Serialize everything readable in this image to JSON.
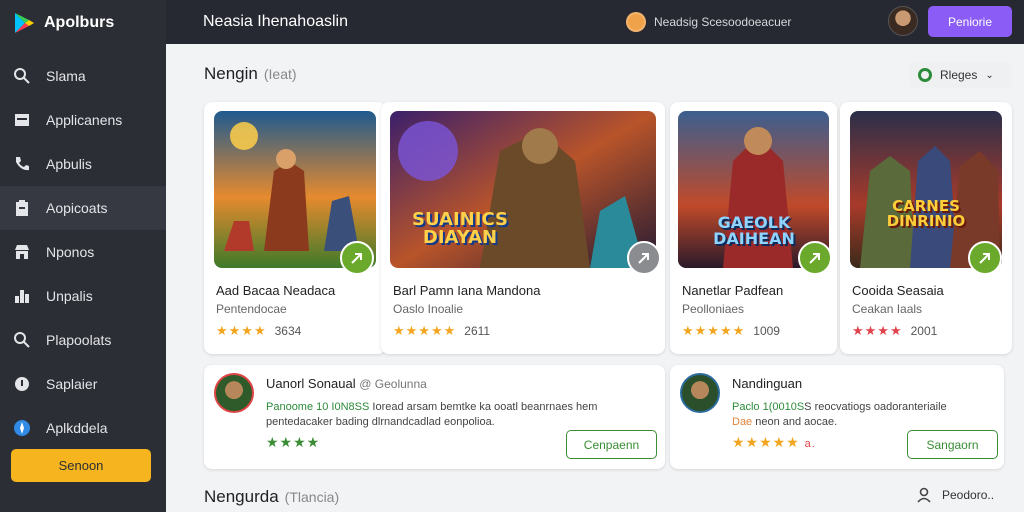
{
  "app": {
    "logo_text": "Apolburs"
  },
  "sidebar": {
    "items": [
      {
        "label": "Slama",
        "icon": "search-icon"
      },
      {
        "label": "Applicanens",
        "icon": "window-icon"
      },
      {
        "label": "Apbulis",
        "icon": "phone-icon"
      },
      {
        "label": "Aopicoats",
        "icon": "clipboard-icon"
      },
      {
        "label": "Nponos",
        "icon": "store-icon"
      },
      {
        "label": "Unpalis",
        "icon": "bar-chart-icon"
      },
      {
        "label": "Plapoolats",
        "icon": "search-icon"
      },
      {
        "label": "Saplaier",
        "icon": "location-icon"
      },
      {
        "label": "Aplkddela",
        "icon": "compass-icon"
      }
    ],
    "button_label": "Senoon"
  },
  "topbar": {
    "title": "Neasia Ihenahoaslin",
    "mid_text": "Neadsig Scesoodoeacuer",
    "button_label": "Peniorie"
  },
  "main": {
    "section1": {
      "title": "Nengin",
      "subtitle": "(Ieat)"
    },
    "filter_label": "Rleges",
    "cards": [
      {
        "name": "Aad Bacaa Neadaca",
        "sub": "Pentendocae",
        "stars": "★★★★",
        "stars_color": "#f2a51e",
        "rating": "3634",
        "art_title": "",
        "fab": "green"
      },
      {
        "name": "Barl Pamn Iana Mandona",
        "sub": "Oaslo Inoalie",
        "stars": "★★★★★",
        "stars_color": "#f2a51e",
        "rating": "2611",
        "art_title": "SUAINICS DIAYAN",
        "fab": "grey"
      },
      {
        "name": "Nanetlar Padfean",
        "sub": "Peolloniaes",
        "stars": "★★★★★",
        "stars_color": "#f2a51e",
        "rating": "1009",
        "art_title": "GAEOLK DAIHEAN",
        "fab": "green"
      },
      {
        "name": "Cooida Seasaia",
        "sub": "Ceakan Iaals",
        "stars": "★★★★",
        "stars_color": "#e0434b",
        "rating": "2001",
        "art_title": "CARNES DINRINIO",
        "fab": "green"
      }
    ],
    "reviews": [
      {
        "name": "Uanorl Sonaual",
        "handle": "@ Geolunna",
        "text_hl": "Panoome 10 I0N8SS",
        "text_rest": " Ioread arsam bemtke ka ooatl beanrnaes hem pentedacaker bading dlrnandcadlad eonpolioa.",
        "stars": "★★★★",
        "button": "Cenpaenn"
      },
      {
        "name": "Nandinguan",
        "handle": "",
        "text_hl": "Paclo 1(0010S",
        "text_rest": "S reocvatiogs oadoranteriaile",
        "text_orange": "Dae",
        "text_rest2": " neon and aocae.",
        "stars": "★★★★★",
        "stars_extra": "a.",
        "button": "Sangaorn"
      }
    ],
    "section2": {
      "title": "Nengurda",
      "subtitle": "(Tlancia)"
    },
    "bottom_right": "Peodoro.."
  }
}
